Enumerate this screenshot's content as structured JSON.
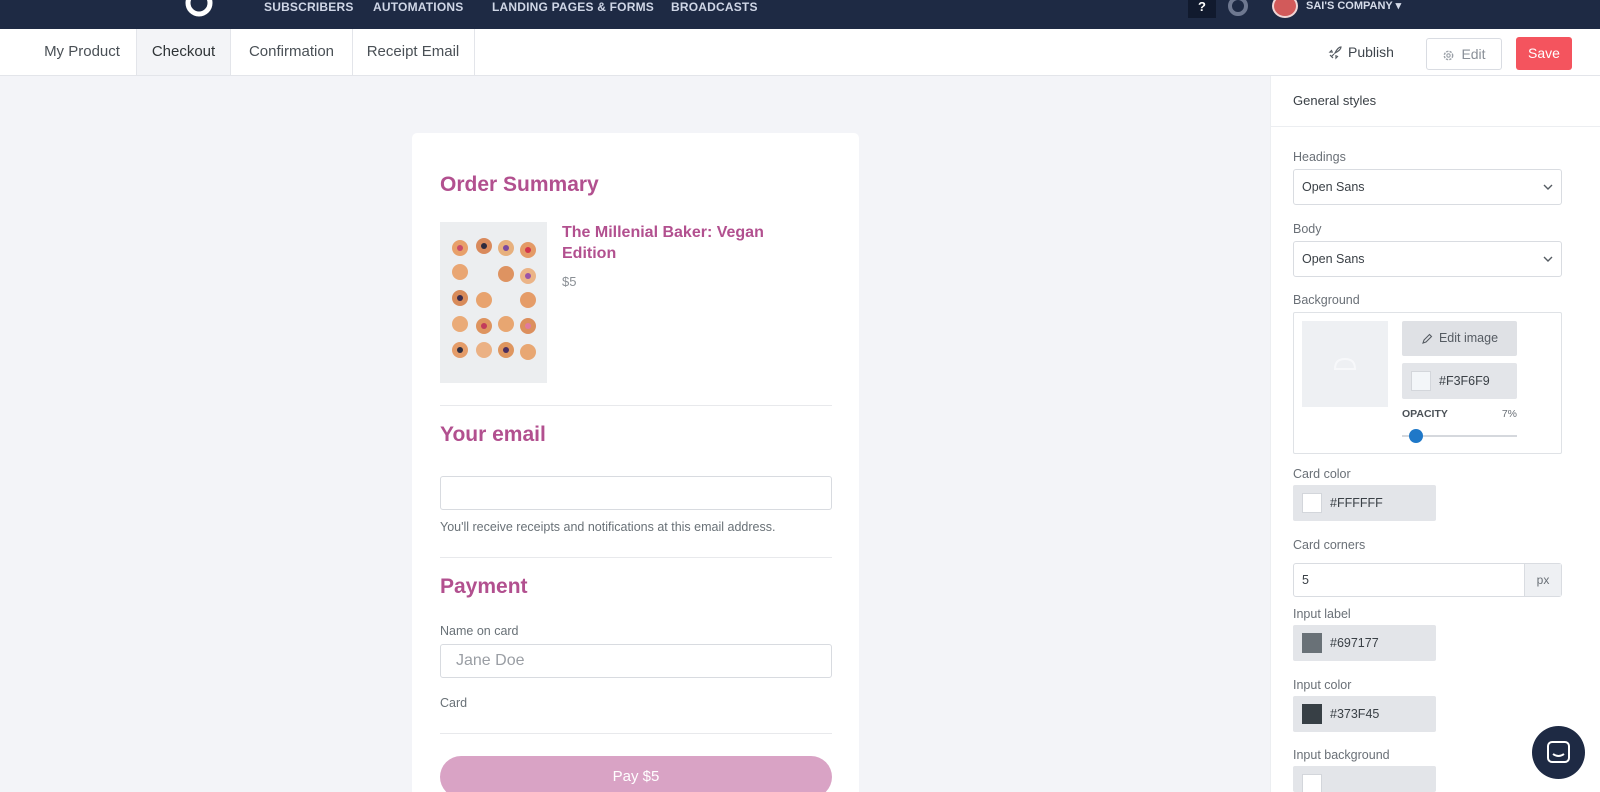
{
  "topnav": {
    "links": [
      "SUBSCRIBERS",
      "AUTOMATIONS",
      "LANDING PAGES & FORMS",
      "BROADCASTS"
    ],
    "help_label": "?",
    "company": "SAI'S COMPANY"
  },
  "tabs": [
    "My Product",
    "Checkout",
    "Confirmation",
    "Receipt Email"
  ],
  "active_tab": "Checkout",
  "actions": {
    "publish": "Publish",
    "edit": "Edit",
    "save": "Save"
  },
  "checkout": {
    "order_summary_heading": "Order Summary",
    "product_title": "The Millenial Baker: Vegan Edition",
    "product_price": "$5",
    "email_heading": "Your email",
    "email_note": "You'll receive receipts and notifications at this email address.",
    "payment_heading": "Payment",
    "name_label": "Name on card",
    "name_placeholder": "Jane Doe",
    "card_label": "Card",
    "pay_button": "Pay $5"
  },
  "panel": {
    "title": "General styles",
    "headings_label": "Headings",
    "headings_value": "Open Sans",
    "body_label": "Body",
    "body_value": "Open Sans",
    "background_label": "Background",
    "edit_image": "Edit image",
    "background_color": "#F3F6F9",
    "opacity_label": "OPACITY",
    "opacity_value": "7%",
    "opacity_fraction": 0.07,
    "card_color_label": "Card color",
    "card_color": "#FFFFFF",
    "card_corners_label": "Card corners",
    "card_corners_value": "5",
    "card_corners_unit": "px",
    "input_label_label": "Input label",
    "input_label_color": "#697177",
    "input_color_label": "Input color",
    "input_color": "#373F45",
    "input_background_label": "Input background"
  },
  "colors": {
    "accent": "#B2508F",
    "save": "#F4545E",
    "nav": "#1E2A44",
    "pay_button": "#D9A3C5"
  }
}
